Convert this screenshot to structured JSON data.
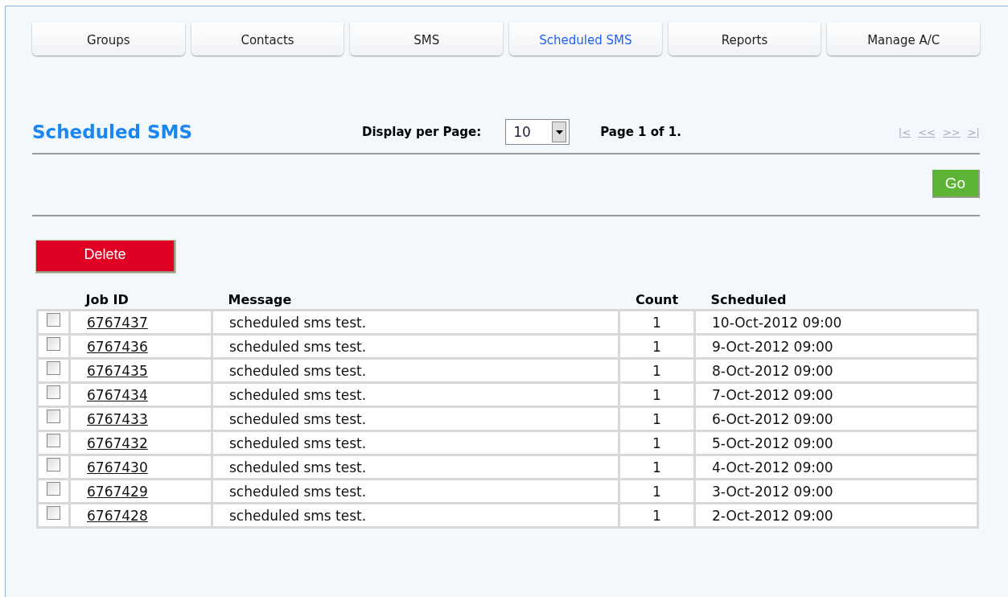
{
  "tabs": [
    {
      "label": "Groups",
      "selected": false
    },
    {
      "label": "Contacts",
      "selected": false
    },
    {
      "label": "SMS",
      "selected": false
    },
    {
      "label": "Scheduled SMS",
      "selected": true
    },
    {
      "label": "Reports",
      "selected": false
    },
    {
      "label": "Manage A/C",
      "selected": false
    }
  ],
  "page_title": "Scheduled SMS",
  "per_page": {
    "label": "Display per Page:",
    "value": "10"
  },
  "page_info": "Page 1 of 1.",
  "pager": [
    {
      "label": "|<",
      "disabled": true
    },
    {
      "label": "<<",
      "disabled": true
    },
    {
      "label": ">>",
      "disabled": true
    },
    {
      "label": ">|",
      "disabled": true
    }
  ],
  "go_button": "Go",
  "delete_button": "Delete",
  "table": {
    "columns": [
      "Job ID",
      "Message",
      "Count",
      "Scheduled"
    ],
    "rows": [
      {
        "checked": false,
        "job_id": "6767437",
        "message": "scheduled sms test.",
        "count": "1",
        "scheduled": "10-Oct-2012 09:00"
      },
      {
        "checked": false,
        "job_id": "6767436",
        "message": "scheduled sms test.",
        "count": "1",
        "scheduled": "9-Oct-2012 09:00"
      },
      {
        "checked": false,
        "job_id": "6767435",
        "message": "scheduled sms test.",
        "count": "1",
        "scheduled": "8-Oct-2012 09:00"
      },
      {
        "checked": false,
        "job_id": "6767434",
        "message": "scheduled sms test.",
        "count": "1",
        "scheduled": "7-Oct-2012 09:00"
      },
      {
        "checked": false,
        "job_id": "6767433",
        "message": "scheduled sms test.",
        "count": "1",
        "scheduled": "6-Oct-2012 09:00"
      },
      {
        "checked": false,
        "job_id": "6767432",
        "message": "scheduled sms test.",
        "count": "1",
        "scheduled": "5-Oct-2012 09:00"
      },
      {
        "checked": false,
        "job_id": "6767430",
        "message": "scheduled sms test.",
        "count": "1",
        "scheduled": "4-Oct-2012 09:00"
      },
      {
        "checked": false,
        "job_id": "6767429",
        "message": "scheduled sms test.",
        "count": "1",
        "scheduled": "3-Oct-2012 09:00"
      },
      {
        "checked": false,
        "job_id": "6767428",
        "message": "scheduled sms test.",
        "count": "1",
        "scheduled": "2-Oct-2012 09:00"
      }
    ]
  }
}
